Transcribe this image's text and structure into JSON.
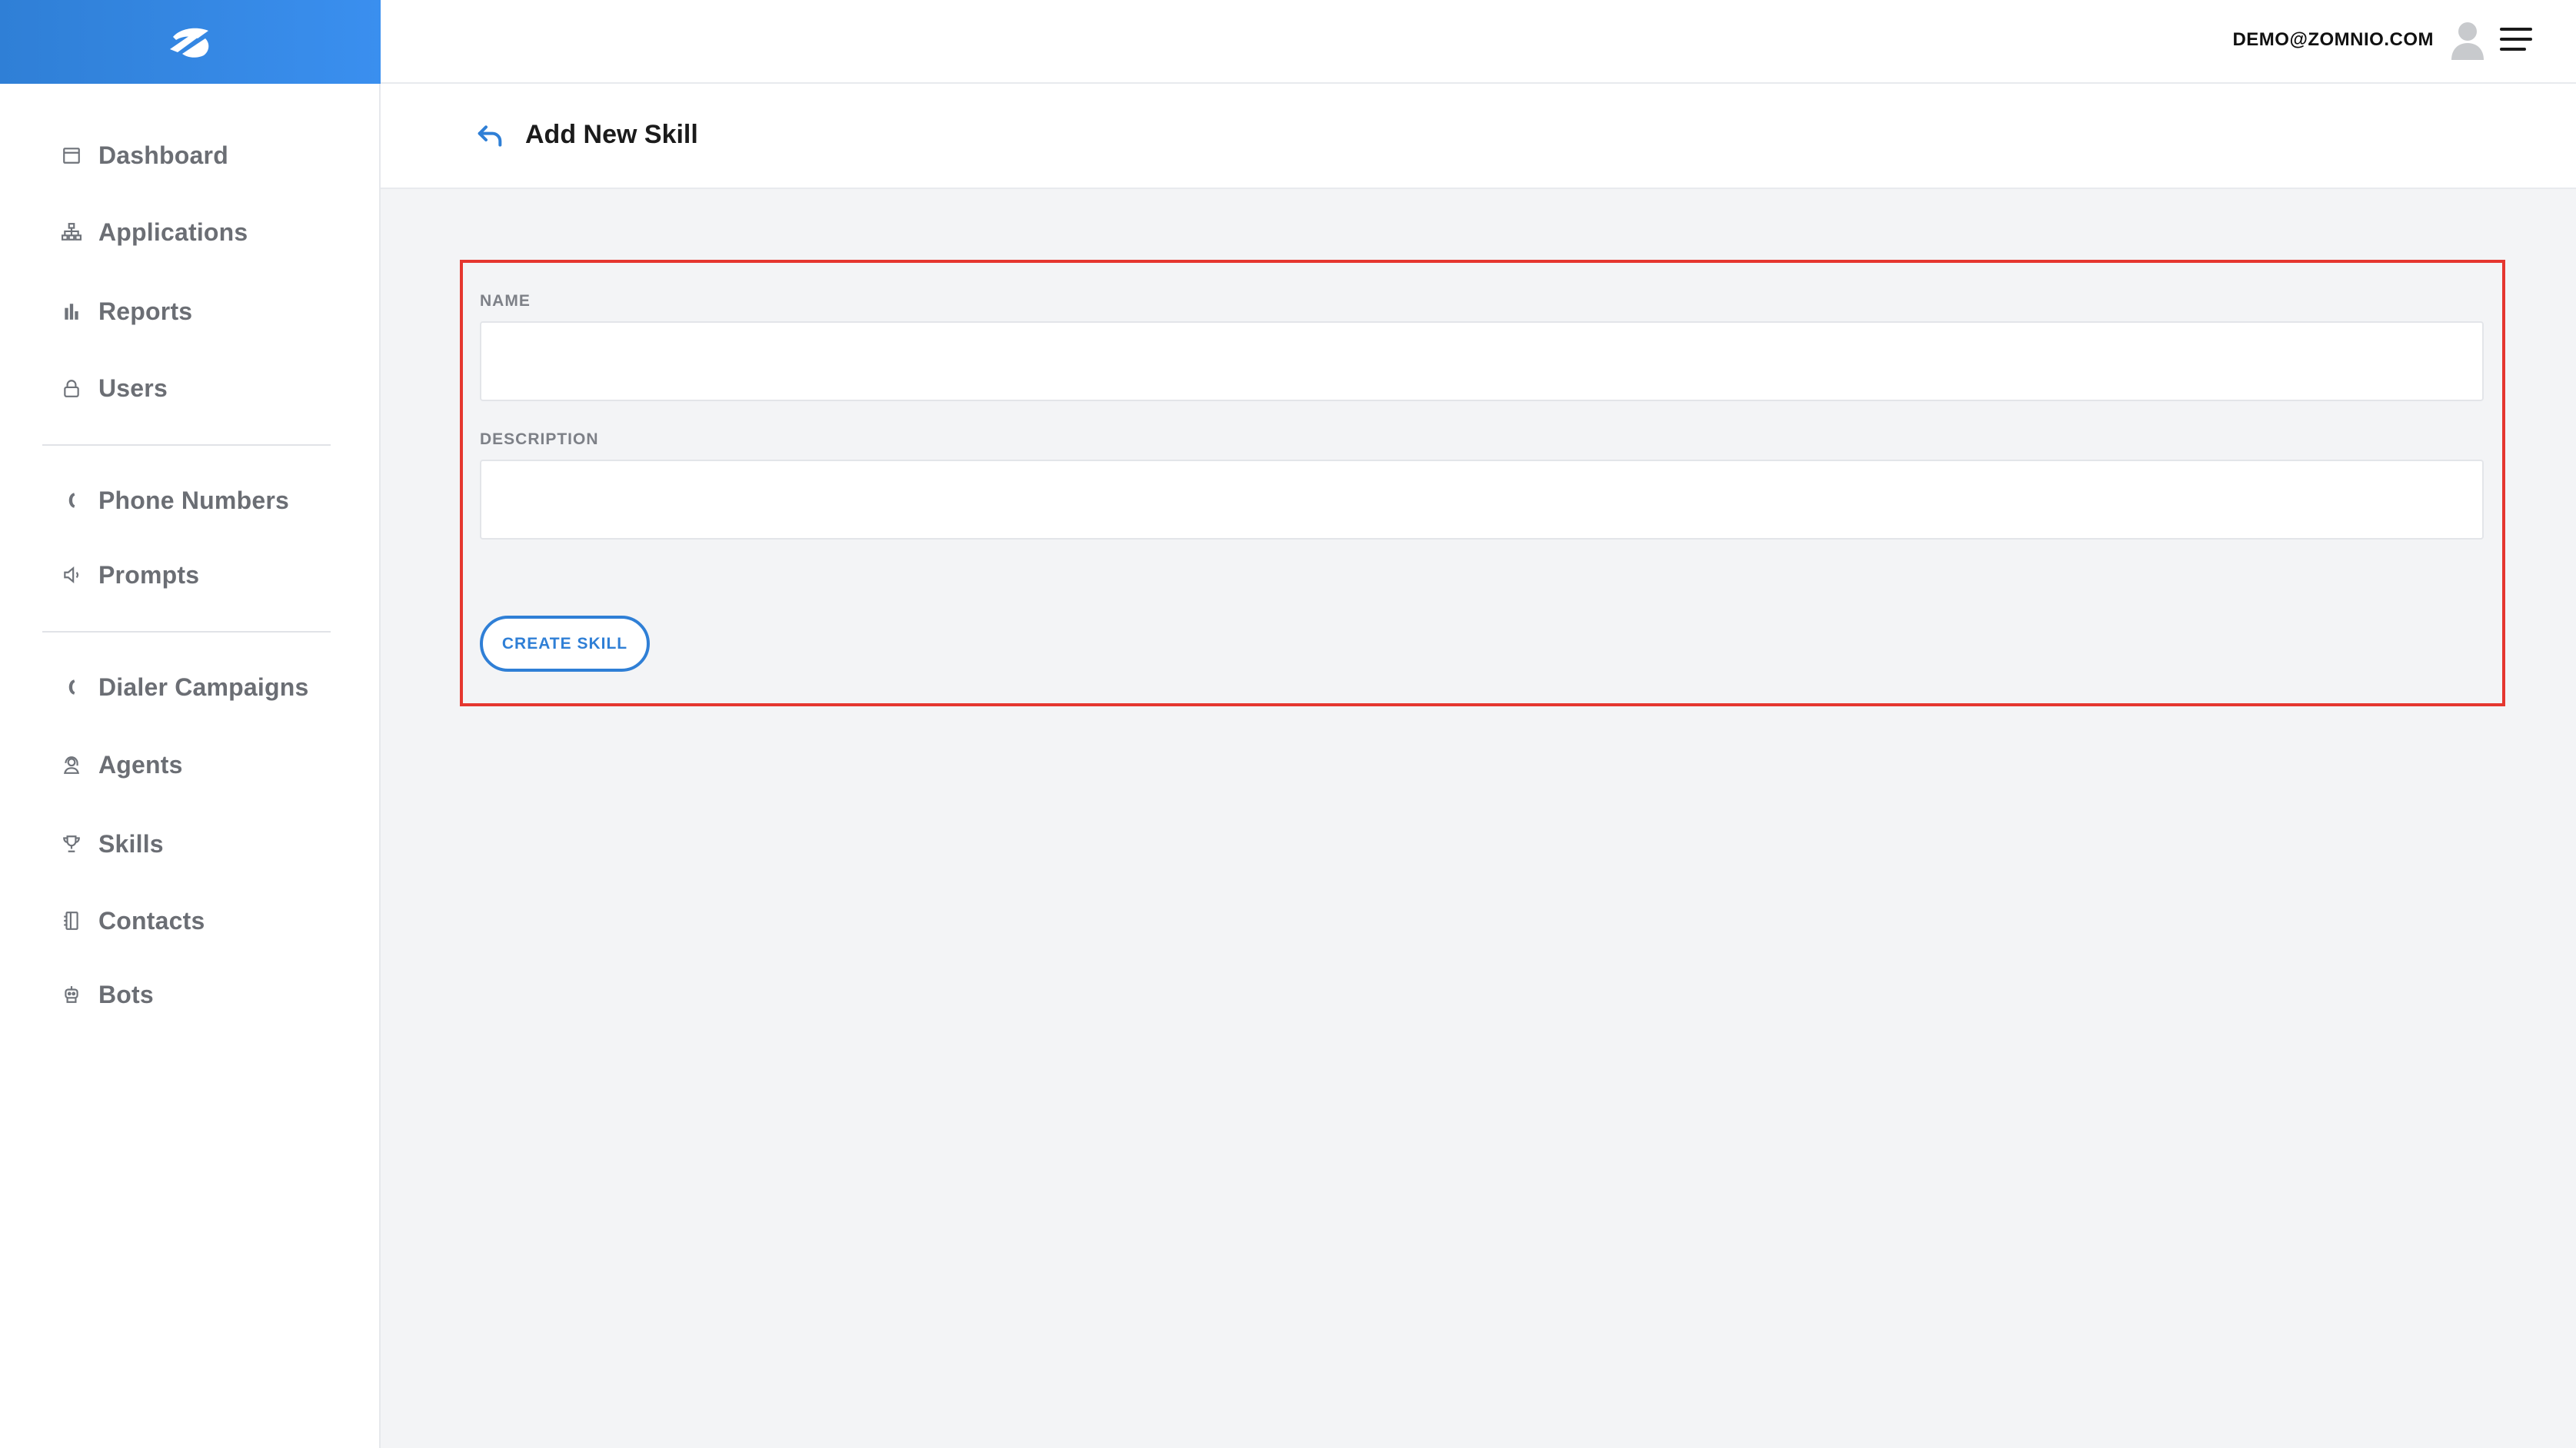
{
  "brand": {
    "logo_icon": "zomnio-logo"
  },
  "topbar": {
    "user_email": "DEMO@ZOMNIO.COM",
    "avatar_icon": "user-avatar-icon",
    "menu_icon": "hamburger-menu-icon"
  },
  "sidebar": {
    "items": [
      {
        "label": "Dashboard",
        "icon": "calendar-icon"
      },
      {
        "label": "Applications",
        "icon": "sitemap-icon"
      },
      {
        "label": "Reports",
        "icon": "bar-chart-icon"
      },
      {
        "label": "Users",
        "icon": "lock-user-icon"
      },
      {
        "label": "Phone Numbers",
        "icon": "phone-icon"
      },
      {
        "label": "Prompts",
        "icon": "speaker-icon"
      },
      {
        "label": "Dialer Campaigns",
        "icon": "phone-icon"
      },
      {
        "label": "Agents",
        "icon": "agent-headset-icon"
      },
      {
        "label": "Skills",
        "icon": "trophy-icon"
      },
      {
        "label": "Contacts",
        "icon": "address-book-icon"
      },
      {
        "label": "Bots",
        "icon": "bot-icon"
      }
    ]
  },
  "page": {
    "title": "Add New Skill",
    "back_icon": "back-arrow-icon"
  },
  "form": {
    "name_label": "NAME",
    "name_value": "",
    "description_label": "DESCRIPTION",
    "description_value": "",
    "submit_label": "CREATE SKILL"
  },
  "colors": {
    "accent": "#2f7fd6",
    "highlight_border": "#e5362f",
    "content_bg": "#f3f4f6"
  }
}
